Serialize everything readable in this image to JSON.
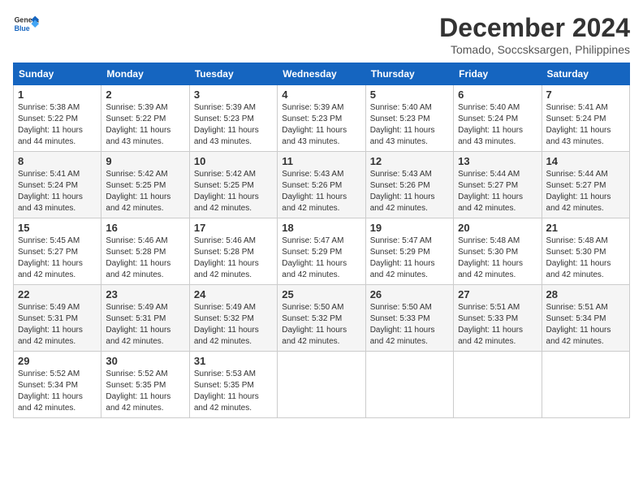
{
  "header": {
    "logo_general": "General",
    "logo_blue": "Blue",
    "month_title": "December 2024",
    "location": "Tomado, Soccsksargen, Philippines"
  },
  "weekdays": [
    "Sunday",
    "Monday",
    "Tuesday",
    "Wednesday",
    "Thursday",
    "Friday",
    "Saturday"
  ],
  "weeks": [
    [
      {
        "day": "1",
        "info": "Sunrise: 5:38 AM\nSunset: 5:22 PM\nDaylight: 11 hours\nand 44 minutes."
      },
      {
        "day": "2",
        "info": "Sunrise: 5:39 AM\nSunset: 5:22 PM\nDaylight: 11 hours\nand 43 minutes."
      },
      {
        "day": "3",
        "info": "Sunrise: 5:39 AM\nSunset: 5:23 PM\nDaylight: 11 hours\nand 43 minutes."
      },
      {
        "day": "4",
        "info": "Sunrise: 5:39 AM\nSunset: 5:23 PM\nDaylight: 11 hours\nand 43 minutes."
      },
      {
        "day": "5",
        "info": "Sunrise: 5:40 AM\nSunset: 5:23 PM\nDaylight: 11 hours\nand 43 minutes."
      },
      {
        "day": "6",
        "info": "Sunrise: 5:40 AM\nSunset: 5:24 PM\nDaylight: 11 hours\nand 43 minutes."
      },
      {
        "day": "7",
        "info": "Sunrise: 5:41 AM\nSunset: 5:24 PM\nDaylight: 11 hours\nand 43 minutes."
      }
    ],
    [
      {
        "day": "8",
        "info": "Sunrise: 5:41 AM\nSunset: 5:24 PM\nDaylight: 11 hours\nand 43 minutes."
      },
      {
        "day": "9",
        "info": "Sunrise: 5:42 AM\nSunset: 5:25 PM\nDaylight: 11 hours\nand 42 minutes."
      },
      {
        "day": "10",
        "info": "Sunrise: 5:42 AM\nSunset: 5:25 PM\nDaylight: 11 hours\nand 42 minutes."
      },
      {
        "day": "11",
        "info": "Sunrise: 5:43 AM\nSunset: 5:26 PM\nDaylight: 11 hours\nand 42 minutes."
      },
      {
        "day": "12",
        "info": "Sunrise: 5:43 AM\nSunset: 5:26 PM\nDaylight: 11 hours\nand 42 minutes."
      },
      {
        "day": "13",
        "info": "Sunrise: 5:44 AM\nSunset: 5:27 PM\nDaylight: 11 hours\nand 42 minutes."
      },
      {
        "day": "14",
        "info": "Sunrise: 5:44 AM\nSunset: 5:27 PM\nDaylight: 11 hours\nand 42 minutes."
      }
    ],
    [
      {
        "day": "15",
        "info": "Sunrise: 5:45 AM\nSunset: 5:27 PM\nDaylight: 11 hours\nand 42 minutes."
      },
      {
        "day": "16",
        "info": "Sunrise: 5:46 AM\nSunset: 5:28 PM\nDaylight: 11 hours\nand 42 minutes."
      },
      {
        "day": "17",
        "info": "Sunrise: 5:46 AM\nSunset: 5:28 PM\nDaylight: 11 hours\nand 42 minutes."
      },
      {
        "day": "18",
        "info": "Sunrise: 5:47 AM\nSunset: 5:29 PM\nDaylight: 11 hours\nand 42 minutes."
      },
      {
        "day": "19",
        "info": "Sunrise: 5:47 AM\nSunset: 5:29 PM\nDaylight: 11 hours\nand 42 minutes."
      },
      {
        "day": "20",
        "info": "Sunrise: 5:48 AM\nSunset: 5:30 PM\nDaylight: 11 hours\nand 42 minutes."
      },
      {
        "day": "21",
        "info": "Sunrise: 5:48 AM\nSunset: 5:30 PM\nDaylight: 11 hours\nand 42 minutes."
      }
    ],
    [
      {
        "day": "22",
        "info": "Sunrise: 5:49 AM\nSunset: 5:31 PM\nDaylight: 11 hours\nand 42 minutes."
      },
      {
        "day": "23",
        "info": "Sunrise: 5:49 AM\nSunset: 5:31 PM\nDaylight: 11 hours\nand 42 minutes."
      },
      {
        "day": "24",
        "info": "Sunrise: 5:49 AM\nSunset: 5:32 PM\nDaylight: 11 hours\nand 42 minutes."
      },
      {
        "day": "25",
        "info": "Sunrise: 5:50 AM\nSunset: 5:32 PM\nDaylight: 11 hours\nand 42 minutes."
      },
      {
        "day": "26",
        "info": "Sunrise: 5:50 AM\nSunset: 5:33 PM\nDaylight: 11 hours\nand 42 minutes."
      },
      {
        "day": "27",
        "info": "Sunrise: 5:51 AM\nSunset: 5:33 PM\nDaylight: 11 hours\nand 42 minutes."
      },
      {
        "day": "28",
        "info": "Sunrise: 5:51 AM\nSunset: 5:34 PM\nDaylight: 11 hours\nand 42 minutes."
      }
    ],
    [
      {
        "day": "29",
        "info": "Sunrise: 5:52 AM\nSunset: 5:34 PM\nDaylight: 11 hours\nand 42 minutes."
      },
      {
        "day": "30",
        "info": "Sunrise: 5:52 AM\nSunset: 5:35 PM\nDaylight: 11 hours\nand 42 minutes."
      },
      {
        "day": "31",
        "info": "Sunrise: 5:53 AM\nSunset: 5:35 PM\nDaylight: 11 hours\nand 42 minutes."
      },
      null,
      null,
      null,
      null
    ]
  ]
}
